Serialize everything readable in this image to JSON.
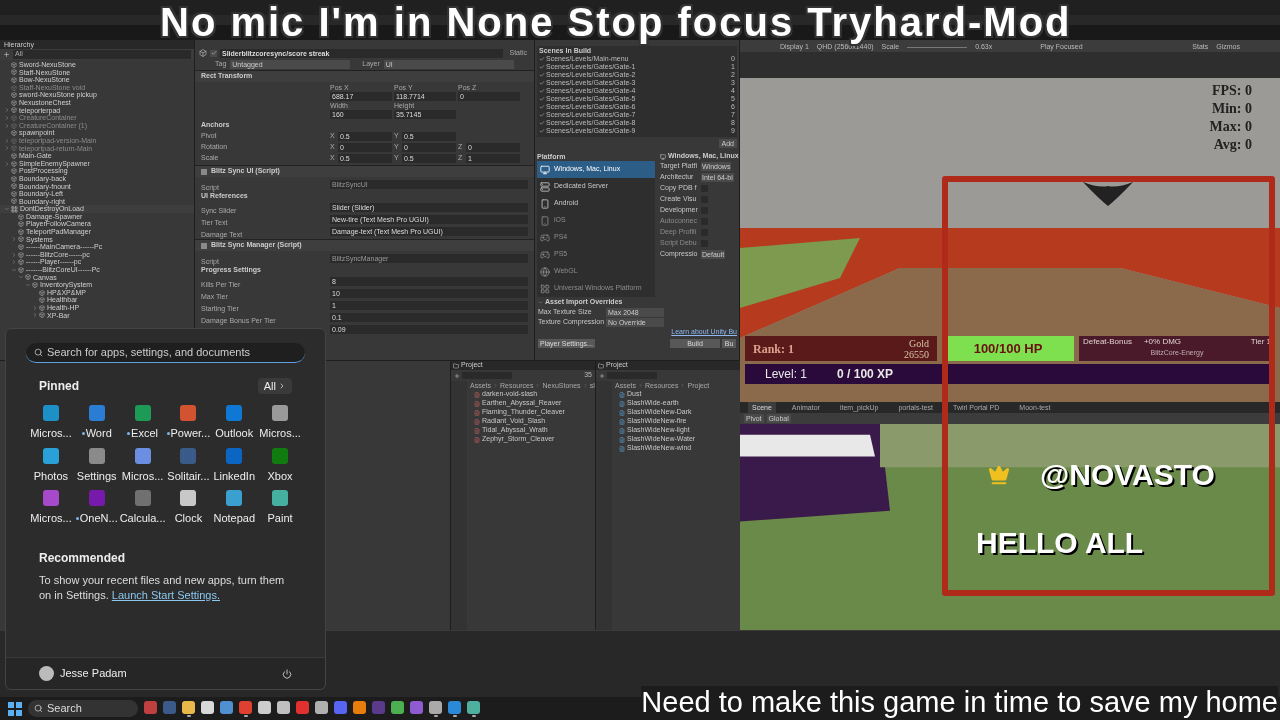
{
  "overlay": {
    "title": "No mic I'm in None Stop focus Tryhard-Mod",
    "caption": "Need to make this game in time to save my home"
  },
  "hierarchy": {
    "title": "Hierarchy",
    "search_placeholder": "All",
    "items": [
      {
        "kind": "object",
        "label": "Sword-NexuStone",
        "disabled": false
      },
      {
        "kind": "object",
        "label": "Staff-NexuStone",
        "disabled": false
      },
      {
        "kind": "object",
        "label": "Bow-NexuStone",
        "disabled": false
      },
      {
        "kind": "object",
        "label": "Staff-NexuStone void",
        "disabled": true
      },
      {
        "kind": "object",
        "label": "sword-NexuStone pickup",
        "disabled": false
      },
      {
        "kind": "object",
        "label": "NexustoneChest",
        "disabled": false
      },
      {
        "kind": "object",
        "label": "teleporterpad",
        "disabled": false,
        "expanded": false
      },
      {
        "kind": "object",
        "label": "CreatureContainer",
        "disabled": true,
        "expanded": false
      },
      {
        "kind": "object",
        "label": "CreatureContainer (1)",
        "disabled": true,
        "expanded": false
      },
      {
        "kind": "object",
        "label": "spawnpoint",
        "disabled": false
      },
      {
        "kind": "object",
        "label": "teleportpad-version-Main",
        "disabled": true,
        "expanded": false
      },
      {
        "kind": "object",
        "label": "teleportpad-return-Main",
        "disabled": true,
        "expanded": false
      },
      {
        "kind": "object",
        "label": "Main-Gate",
        "disabled": false
      },
      {
        "kind": "object",
        "label": "SimpleEnemySpawner",
        "disabled": false,
        "expanded": false
      },
      {
        "kind": "object",
        "label": "PostProcessing",
        "disabled": false
      },
      {
        "kind": "object",
        "label": "Boundary-back",
        "disabled": false
      },
      {
        "kind": "object",
        "label": "Boundary-fnount",
        "disabled": false
      },
      {
        "kind": "object",
        "label": "Boundary-Left",
        "disabled": false
      },
      {
        "kind": "object",
        "label": "Boundary-right",
        "disabled": false
      },
      {
        "kind": "scene",
        "label": "DontDestroyOnLoad",
        "disabled": false,
        "expanded": true,
        "children": [
          {
            "kind": "object",
            "label": "Damage-Spawner",
            "disabled": false
          },
          {
            "kind": "object",
            "label": "PlayerFollowCamera",
            "disabled": false
          },
          {
            "kind": "object",
            "label": "TeleportPadManager",
            "disabled": false
          },
          {
            "kind": "object",
            "label": "Systems",
            "disabled": false,
            "expanded": false
          },
          {
            "kind": "object",
            "label": "------MainCamera------Pc",
            "disabled": false
          },
          {
            "kind": "object",
            "label": "------BlitzCore------pc",
            "disabled": false,
            "expanded": false
          },
          {
            "kind": "object",
            "label": "------Player------pc",
            "disabled": false,
            "expanded": false
          },
          {
            "kind": "object",
            "label": "-------BlitzCoreUI------Pc",
            "disabled": false,
            "expanded": true,
            "children": [
              {
                "kind": "object",
                "label": "Canvas",
                "disabled": false,
                "expanded": true,
                "children": [
                  {
                    "kind": "object",
                    "label": "InventorySystem",
                    "disabled": false,
                    "expanded": true,
                    "children": [
                      {
                        "kind": "object",
                        "label": "HP&XP&MP",
                        "disabled": false
                      },
                      {
                        "kind": "object",
                        "label": "Healthbar",
                        "disabled": false
                      },
                      {
                        "kind": "object",
                        "label": "Health-HP",
                        "disabled": false,
                        "expanded": false
                      },
                      {
                        "kind": "object",
                        "label": "XP-Bar",
                        "disabled": false,
                        "expanded": false
                      }
                    ]
                  }
                ]
              }
            ]
          }
        ]
      }
    ]
  },
  "inspector": {
    "object_name": "Sliderblitzcoresync/score streak",
    "active": true,
    "static_label": "Static",
    "tag_label": "Tag",
    "tag": "Untagged",
    "layer_label": "Layer",
    "layer": "UI",
    "components": [
      {
        "title": "Rect Transform",
        "rows": [
          {
            "kind": "grid",
            "cells": [
              {
                "label": "Pos X",
                "value": "688.17"
              },
              {
                "label": "Pos Y",
                "value": "118.7714"
              },
              {
                "label": "Pos Z",
                "value": "0"
              }
            ]
          },
          {
            "kind": "grid",
            "cells": [
              {
                "label": "Width",
                "value": "160"
              },
              {
                "label": "Height",
                "value": "35.7145"
              }
            ]
          },
          {
            "kind": "section",
            "label": "Anchors"
          },
          {
            "kind": "vector",
            "label": "Pivot",
            "parts": [
              {
                "axis": "X",
                "value": "0.5"
              },
              {
                "axis": "Y",
                "value": "0.5"
              }
            ]
          },
          {
            "kind": "vector",
            "label": "Rotation",
            "parts": [
              {
                "axis": "X",
                "value": "0"
              },
              {
                "axis": "Y",
                "value": "0"
              },
              {
                "axis": "Z",
                "value": "0"
              }
            ]
          },
          {
            "kind": "vector",
            "label": "Scale",
            "parts": [
              {
                "axis": "X",
                "value": "0.5"
              },
              {
                "axis": "Y",
                "value": "0.5"
              },
              {
                "axis": "Z",
                "value": "1"
              }
            ]
          }
        ]
      },
      {
        "title": "Blitz Sync UI (Script)",
        "enabled": true,
        "rows": [
          {
            "kind": "field",
            "label": "Script",
            "value": "BlitzSyncUI",
            "disabled": true
          },
          {
            "kind": "section",
            "label": "UI References"
          },
          {
            "kind": "field",
            "label": "Sync Slider",
            "value": "Slider (Slider)",
            "disabled": false
          },
          {
            "kind": "field",
            "label": "Tier Text",
            "value": "New-tire (Text Mesh Pro UGUI)",
            "disabled": false
          },
          {
            "kind": "field",
            "label": "Damage Text",
            "value": "Damage-text (Text Mesh Pro UGUI)",
            "disabled": false
          }
        ]
      },
      {
        "title": "Blitz Sync Manager (Script)",
        "enabled": true,
        "rows": [
          {
            "kind": "field",
            "label": "Script",
            "value": "BlitzSyncManager",
            "disabled": true
          },
          {
            "kind": "section",
            "label": "Progress Settings"
          },
          {
            "kind": "field",
            "label": "Kills Per Tier",
            "value": "8",
            "disabled": false
          },
          {
            "kind": "field",
            "label": "Max Tier",
            "value": "10",
            "disabled": false
          },
          {
            "kind": "field",
            "label": "Starting Tier",
            "value": "1",
            "disabled": false
          },
          {
            "kind": "field",
            "label": "Damage Bonus Per Tier",
            "value": "0.1",
            "disabled": false
          },
          {
            "kind": "field",
            "value": "0.09",
            "disabled": false
          }
        ]
      }
    ]
  },
  "build": {
    "scenes_title": "Scenes In Build",
    "scenes": [
      {
        "path": "Scenes/Levels/Main-menu",
        "index": "0",
        "checked": true
      },
      {
        "path": "Scenes/Levels/Gates/Gate-1",
        "index": "1",
        "checked": true
      },
      {
        "path": "Scenes/Levels/Gates/Gate-2",
        "index": "2",
        "checked": true
      },
      {
        "path": "Scenes/Levels/Gates/Gate-3",
        "index": "3",
        "checked": true
      },
      {
        "path": "Scenes/Levels/Gates/Gate-4",
        "index": "4",
        "checked": true
      },
      {
        "path": "Scenes/Levels/Gates/Gate-5",
        "index": "5",
        "checked": true
      },
      {
        "path": "Scenes/Levels/Gates/Gate-6",
        "index": "6",
        "checked": true
      },
      {
        "path": "Scenes/Levels/Gates/Gate-7",
        "index": "7",
        "checked": true
      },
      {
        "path": "Scenes/Levels/Gates/Gate-8",
        "index": "8",
        "checked": true
      },
      {
        "path": "Scenes/Levels/Gates/Gate-9",
        "index": "9",
        "checked": true
      }
    ],
    "add_button": "Add",
    "platform_title": "Platform",
    "platforms": [
      {
        "name": "Windows, Mac, Linux",
        "kind": "desktop",
        "selected": true,
        "disabled": false
      },
      {
        "name": "Dedicated Server",
        "kind": "server",
        "selected": false,
        "disabled": false
      },
      {
        "name": "Android",
        "kind": "android",
        "selected": false,
        "disabled": false
      },
      {
        "name": "iOS",
        "kind": "ios",
        "selected": false,
        "disabled": true
      },
      {
        "name": "PS4",
        "kind": "console",
        "selected": false,
        "disabled": true
      },
      {
        "name": "PS5",
        "kind": "console",
        "selected": false,
        "disabled": true
      },
      {
        "name": "WebGL",
        "kind": "web",
        "selected": false,
        "disabled": true
      },
      {
        "name": "Universal Windows Platform",
        "kind": "windows",
        "selected": false,
        "disabled": true
      }
    ],
    "settings_title": "Windows, Mac, Linux",
    "settings": [
      {
        "kind": "select",
        "label": "Target Platfi",
        "value": "Windows"
      },
      {
        "kind": "select",
        "label": "Architectur",
        "value": "Intel 64-bi"
      },
      {
        "kind": "checkbox",
        "label": "Copy PDB f",
        "checked": false,
        "disabled": false
      },
      {
        "kind": "checkbox",
        "label": "Create Visu",
        "checked": false,
        "disabled": false
      },
      {
        "kind": "checkbox",
        "label": "Developmer",
        "checked": false,
        "disabled": false
      },
      {
        "kind": "checkbox",
        "label": "Autoconnec",
        "checked": false,
        "disabled": true
      },
      {
        "kind": "checkbox",
        "label": "Deep Profili",
        "checked": false,
        "disabled": true
      },
      {
        "kind": "checkbox",
        "label": "Script Debu",
        "checked": false,
        "disabled": true
      },
      {
        "kind": "select",
        "label": "Compressio",
        "value": "Default"
      }
    ],
    "overrides_title": "Asset Import Overrides",
    "overrides": [
      {
        "label": "Max Texture Size",
        "value": "Max 2048"
      },
      {
        "label": "Texture Compression",
        "value": "No Override"
      }
    ],
    "learn_link": "Learn about Unity Bu",
    "player_settings": "Player Settings...",
    "build_button": "Build",
    "build_and_run": "Bu"
  },
  "game": {
    "display": "Display 1",
    "resolution": "QHD (2560x1440)",
    "scale_label": "Scale",
    "scale": "0.63x",
    "play_mode": "Play Focused",
    "stats": "Stats",
    "gizmos": "Gizmos",
    "fps": [
      "FPS: 0",
      "Min: 0",
      "Max: 0",
      "Avg: 0"
    ],
    "rank": "Rank: 1",
    "gold_label": "Gold",
    "gold": "26550",
    "hp": "100/100 HP",
    "bonus": "Defeat-Bonus",
    "bonus_value": "+0% DMG",
    "tier": "Tier 1",
    "energy": "BlitzCore-Energy",
    "level": "Level: 1",
    "xp": "0 / 100 XP"
  },
  "webcam": {
    "handle": "@NOVASTO",
    "message": "HELLO ALL"
  },
  "scene_view": {
    "tabs": [
      {
        "label": "Scene",
        "selected": true
      },
      {
        "label": "Animator",
        "selected": false
      },
      {
        "label": "item_pickUp",
        "selected": false
      },
      {
        "label": "portals-test",
        "selected": false
      },
      {
        "label": "Twirl Portal PD",
        "selected": false
      },
      {
        "label": "Moon-test",
        "selected": false
      }
    ],
    "pivot": "Pivot",
    "global": "Global"
  },
  "projects": [
    {
      "title": "Project",
      "badge": "35",
      "breadcrumb": [
        "Assets",
        "Resources",
        "NexuStones",
        "sl"
      ],
      "files": [
        "darken-void-slash",
        "Earthen_Abyssal_Reaver",
        "Flaming_Thunder_Cleaver",
        "Radiant_Void_Slash",
        "Tidal_Abyssal_Wrath",
        "Zephyr_Storm_Cleaver"
      ]
    },
    {
      "title": "Project",
      "breadcrumb": [
        "Assets",
        "Resources",
        "Project"
      ],
      "files": [
        "Dust",
        "SlashWide-earth",
        "SlashWideNew-Dark",
        "SlashWideNew-fire",
        "SlashWideNew-light",
        "SlashWideNew-Water",
        "SlashWideNew-wind"
      ]
    }
  ],
  "start_menu": {
    "search_placeholder": "Search for apps, settings, and documents",
    "pinned_title": "Pinned",
    "all_button": "All",
    "apps": [
      {
        "name": "Micros...",
        "color": "#1e90c8",
        "new": false
      },
      {
        "name": "Word",
        "color": "#2b7cd3",
        "new": true
      },
      {
        "name": "Excel",
        "color": "#1d9a55",
        "new": true
      },
      {
        "name": "Power...",
        "color": "#d35230",
        "new": true
      },
      {
        "name": "Outlook",
        "color": "#0f78d4",
        "new": false
      },
      {
        "name": "Micros...",
        "color": "#9a9a9a",
        "new": false
      },
      {
        "name": "Photos",
        "color": "#2aa0d8",
        "new": false
      },
      {
        "name": "Settings",
        "color": "#8a8a8a",
        "new": false
      },
      {
        "name": "Micros...",
        "color": "#6c8ee0",
        "new": false
      },
      {
        "name": "Solitair...",
        "color": "#3a5a8a",
        "new": false
      },
      {
        "name": "LinkedIn",
        "color": "#0a66c2",
        "new": false
      },
      {
        "name": "Xbox",
        "color": "#107c10",
        "new": false
      },
      {
        "name": "Micros...",
        "color": "#a64ac9",
        "new": false
      },
      {
        "name": "OneN...",
        "color": "#7719aa",
        "new": true
      },
      {
        "name": "Calcula...",
        "color": "#707070",
        "new": false
      },
      {
        "name": "Clock",
        "color": "#c8c8c8",
        "new": false
      },
      {
        "name": "Notepad",
        "color": "#3aa0d0",
        "new": false
      },
      {
        "name": "Paint",
        "color": "#46b0a0",
        "new": false
      }
    ],
    "recommended_title": "Recommended",
    "recommended_text": "To show your recent files and new apps, turn them on in Settings.",
    "recommended_link": "Launch Start Settings.",
    "user": "Jesse Padam"
  },
  "taskbar": {
    "search": "Search",
    "apps": [
      {
        "color": "#c04040",
        "running": false
      },
      {
        "color": "#3b5a8a",
        "running": false
      },
      {
        "color": "#e8b84a",
        "running": true
      },
      {
        "color": "#d8d8d8",
        "running": false
      },
      {
        "color": "#5090d0",
        "running": false
      },
      {
        "color": "#e04030",
        "running": true
      },
      {
        "color": "#cccccc",
        "running": false
      },
      {
        "color": "#c0c0c0",
        "running": false
      },
      {
        "color": "#e03030",
        "running": false
      },
      {
        "color": "#b0b0b0",
        "running": false
      },
      {
        "color": "#5865f2",
        "running": false
      },
      {
        "color": "#e87d0d",
        "running": false
      },
      {
        "color": "#5a3a8a",
        "running": false
      },
      {
        "color": "#4caf50",
        "running": false
      },
      {
        "color": "#8e5cd0",
        "running": false
      },
      {
        "color": "#aaaaaa",
        "running": true
      },
      {
        "color": "#2a8ad8",
        "running": true
      },
      {
        "color": "#50b0a0",
        "running": true
      }
    ]
  }
}
